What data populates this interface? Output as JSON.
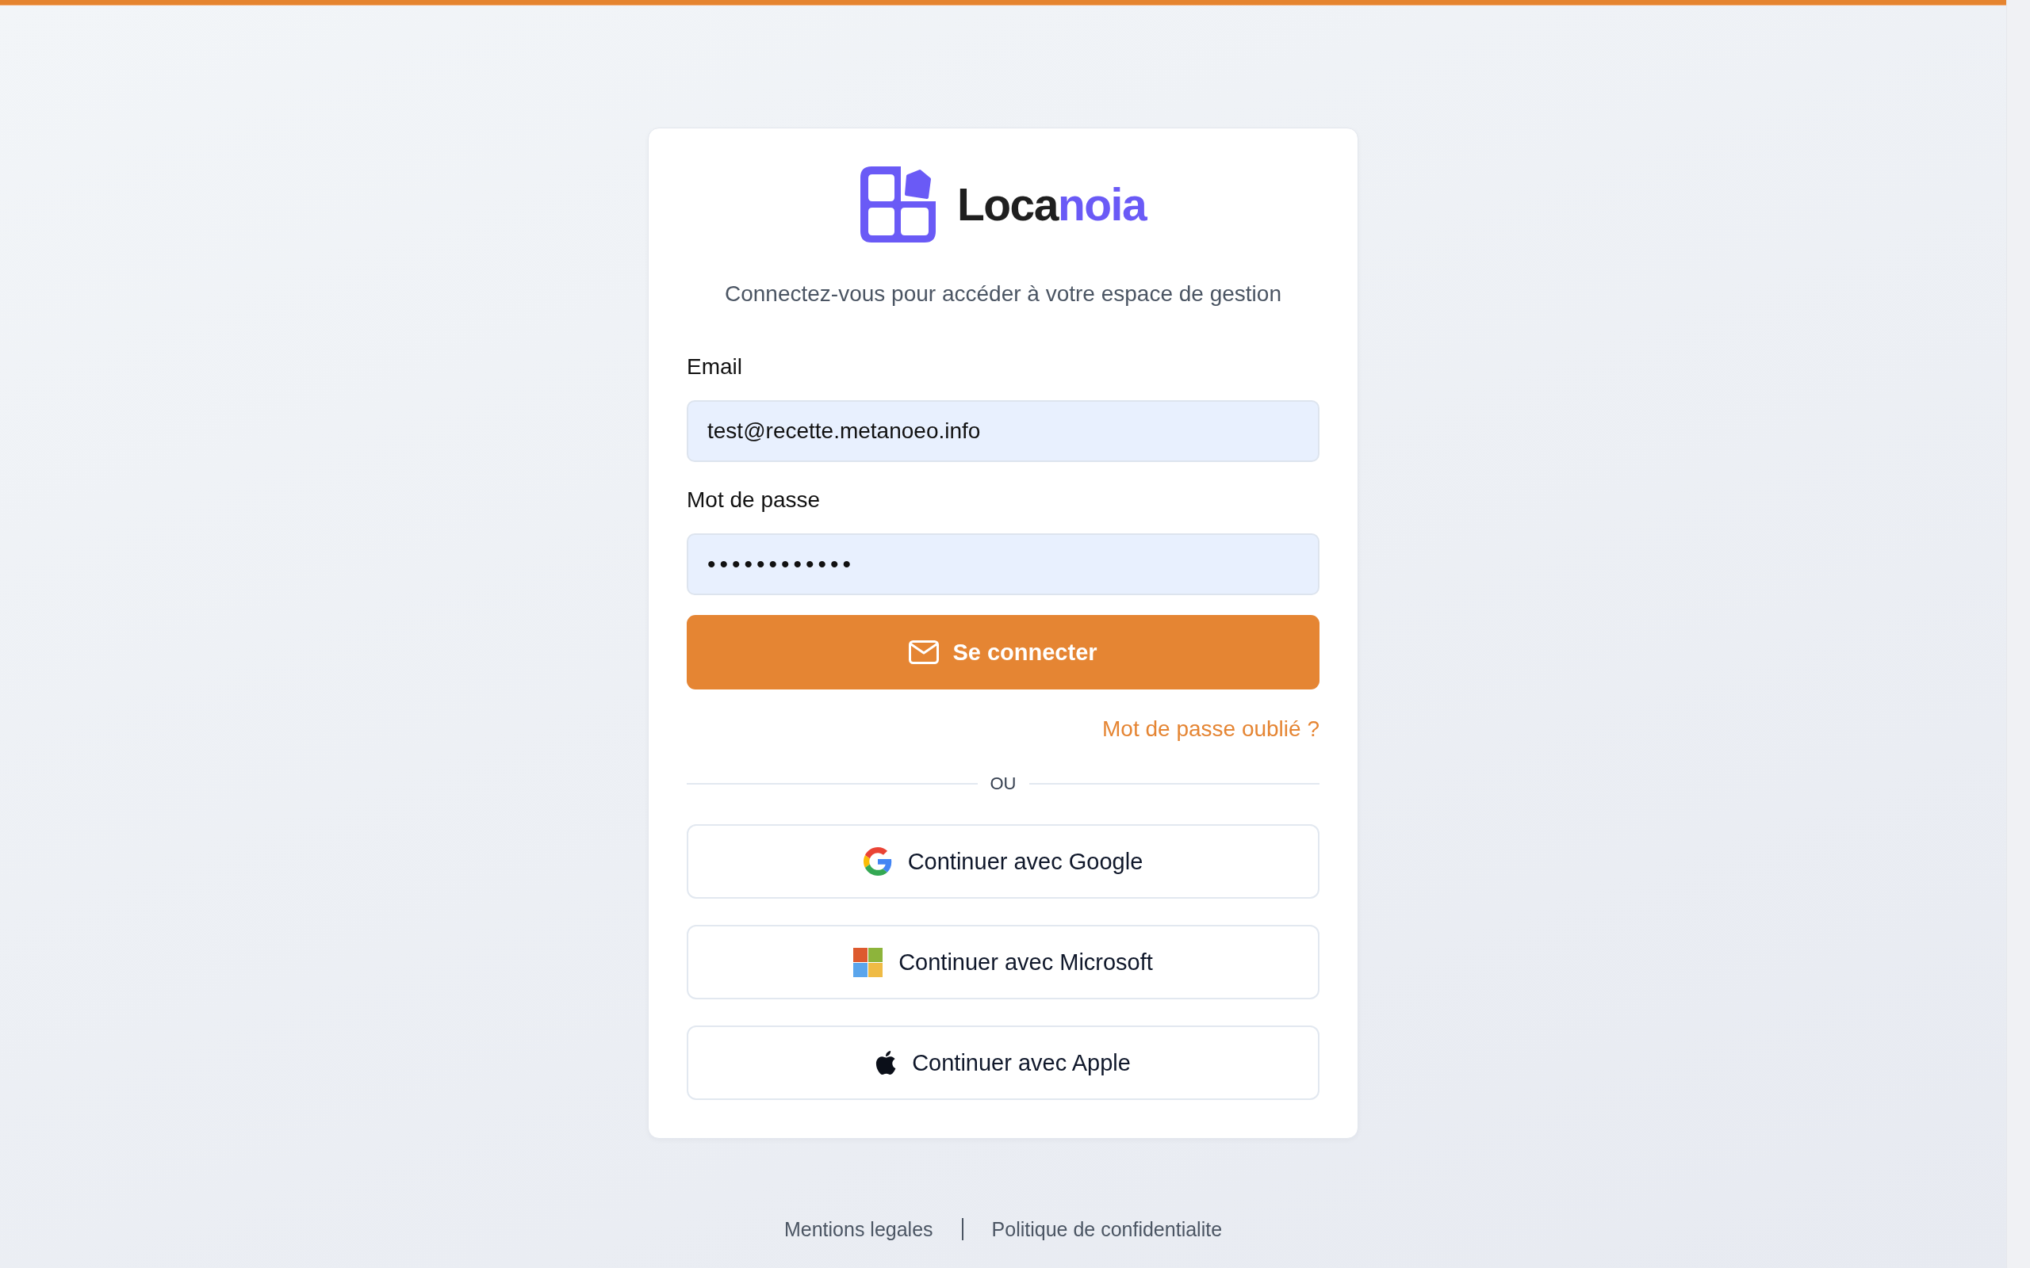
{
  "logo": {
    "wordmark": "Loca",
    "wordmark_accent": "noia"
  },
  "subtitle": "Connectez-vous pour accéder à votre espace de gestion",
  "fields": [
    {
      "kind": "email",
      "label": "Email",
      "value": "test@recette.metanoeo.info"
    },
    {
      "kind": "password",
      "label": "Mot de passe",
      "value": "••••••••••••"
    }
  ],
  "submit_button": "Se connecter",
  "forgot_password_link": "Mot de passe oublié ?",
  "separator": "OU",
  "social_buttons": [
    {
      "kind": "google",
      "label": "Continuer avec Google"
    },
    {
      "kind": "microsoft",
      "label": "Continuer avec Microsoft"
    },
    {
      "kind": "apple",
      "label": "Continuer avec Apple"
    }
  ],
  "footer_links": [
    "Mentions legales",
    "Politique de confidentialite"
  ]
}
